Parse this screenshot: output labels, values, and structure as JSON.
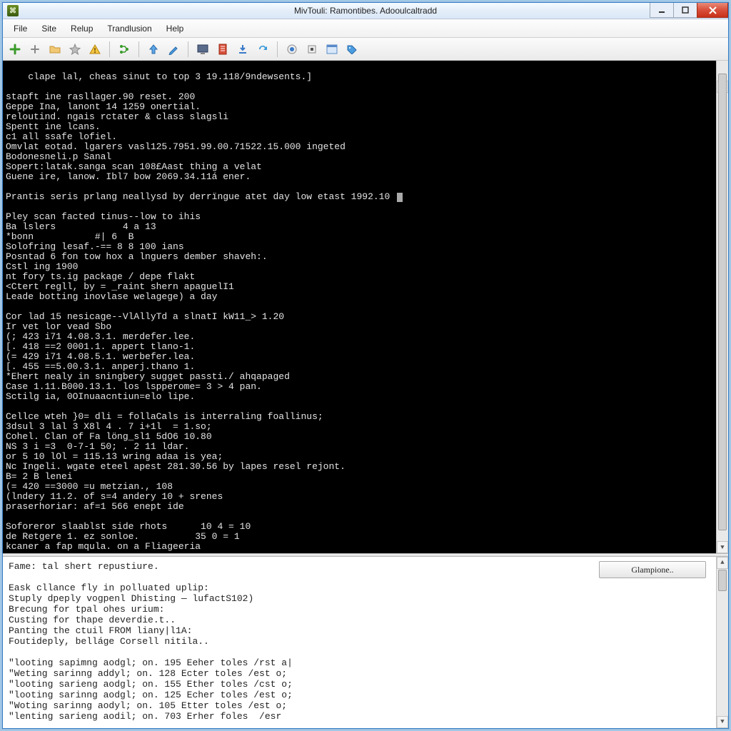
{
  "window": {
    "title": "MivTouli: Ramontibes. Adooulcaltradd"
  },
  "menu": {
    "items": [
      "File",
      "Site",
      "Relup",
      "Trandlusion",
      "Help"
    ]
  },
  "toolbar": {
    "icons": [
      "plus-green-icon",
      "plus-gray-icon",
      "folder-icon",
      "star-icon",
      "warning-icon",
      "sep",
      "branch-icon",
      "sep",
      "arrow-up-icon",
      "pencil-icon",
      "sep",
      "monitor-icon",
      "page-red-icon",
      "download-icon",
      "refresh-icon",
      "sep",
      "record-icon",
      "stop-icon",
      "window-icon",
      "tag-icon"
    ]
  },
  "terminal": {
    "lines_pre": [
      "clape lal, cheas sinut to top 3 19.118/9ndewsents.]",
      "",
      "stapft ine rasllager.90 reset. 200",
      "Geppe Ina, lanont 14 1259 onertial.",
      "reloutind. ngais rctater & class slagsli",
      "Spentt ine lcans.",
      "c1 all ssafe lofiel.",
      "Omvlat eotad. lgarers vasl125.7951.99.00.71522.15.000 ingeted",
      "Bodonesneli.p Sanal",
      "Sopert:latak.sanga scan 108£Aast thing a velat",
      "Guene ire, lanow. Ibl7 bow 2069.34.11á ener.",
      ""
    ],
    "prompt_line": "Prantis seris prlang neallysd by derrïngue atet day low etast 1992.10 ",
    "lines_post": [
      "",
      "Pley scan facted tinus--low to ihis",
      "Ba lslers            4 a 13",
      "*bonn           #| 6  B",
      "Solofring lesaf.-== 8 8 100 ians",
      "Posntad 6 fon tow hox a lnguers dember shaveh:.",
      "Cstl ing 1900",
      "nt fory ts.ig package / depe flakt",
      "<Ctert regll, by = _raint shern apaguelI1",
      "Leade botting inovlase welagege) a day",
      "",
      "Cor lad 15 nesicage--VlAllyTd a slnatI kW11_> 1.20",
      "Ir vet lor vead Sbo",
      "(; 423 i71 4.08.3.1. merdefer.lee.",
      "[. 418 ==2 0001.1. appert tlano-1.",
      "(= 429 i71 4.08.5.1. werbefer.lea.",
      "[. 455 ==5.00.3.1. anperj.thano 1.",
      "*Ehert nealy in sningbery sugget passti./ ahqapaged",
      "Case 1.11.B000.13.1. los lspperome= 3 > 4 pan.",
      "Sctilg ia, 0OInuaacntiun=elo lipe.",
      "",
      "Cellce wteh }0= dli = follaCals is interraling foallinus;",
      "3dsul 3 lal 3 X8l 4 . 7 i+1l  = 1.so;",
      "Cohel. Clan of Fa löng_sl1 5dO6 10.80",
      "NS 3 i =3  0-7-1 50; . 2 11 ldar.",
      "or 5 10 lOl = 115.13 wring adaa is yea;",
      "Nc Ingeli. wgate eteel apest 281.30.56 by lapes resel rejont.",
      "B= 2 B lenei",
      "(= 420 ==3000 =u metzian., 108",
      "(lndery 11.2. of s=4 andery 10 + srenes",
      "praserhoriar: af=1 566 enept ide",
      "",
      "Soforeror slaablst side rhots      10 4 = 10",
      "de Retgere 1. ez sonloe.          35 0 = 1",
      "kcaner a fap mqula. on a Fliageeria"
    ]
  },
  "log": {
    "button": "Glampione..",
    "lines": [
      "Fame: tal shert repustiure.",
      "",
      "Eask cllance fly in polluated uplip:",
      "Stuply dpeply vogpenl Dhisting — lufactS102)",
      "Brecung for tpal ohes urium:",
      "Custing for thape deverdie.t..",
      "Panting the ctuil FROM liany|l1A:",
      "Foutideply, belláge Corsell nitila..",
      "",
      "\"looting sapimng aodgl; on. 195 Eeher toles /rst a|",
      "\"Weting sarinng addyl; on. 128 Ecter toles /est o;",
      "\"looting sarieng aodgl; on. 155 Ether toles /cst o;",
      "\"looting sarinng aodgl; on. 125 Echer toles /est o;",
      "\"Woting sarinng aodyl; on. 105 Etter toles /est o;",
      "\"lenting sarieng aodil; on. 703 Erher foles  /esr"
    ]
  }
}
